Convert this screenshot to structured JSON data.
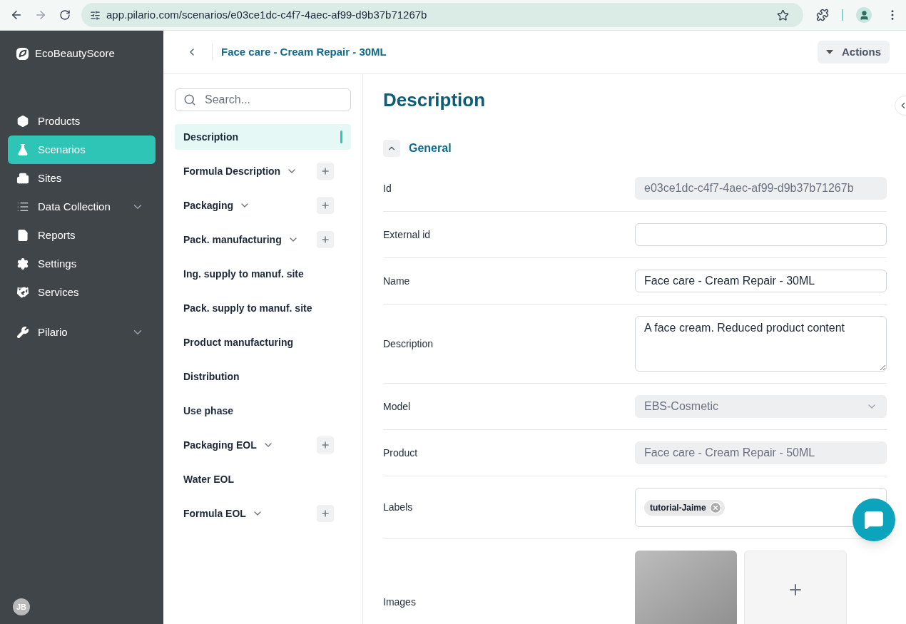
{
  "browser": {
    "url": "app.pilario.com/scenarios/e03ce1dc-c4f7-4aec-af99-d9b37b71267b"
  },
  "sidebar": {
    "brand": "EcoBeautyScore",
    "items": [
      {
        "label": "Products",
        "selected": false,
        "expandable": false
      },
      {
        "label": "Scenarios",
        "selected": true,
        "expandable": false
      },
      {
        "label": "Sites",
        "selected": false,
        "expandable": false
      },
      {
        "label": "Data Collection",
        "selected": false,
        "expandable": true
      },
      {
        "label": "Reports",
        "selected": false,
        "expandable": false
      },
      {
        "label": "Settings",
        "selected": false,
        "expandable": false
      },
      {
        "label": "Services",
        "selected": false,
        "expandable": false
      }
    ],
    "extra": [
      {
        "label": "Pilario",
        "selected": false,
        "expandable": true
      }
    ],
    "user_initials": "JB"
  },
  "header": {
    "title": "Face care - Cream Repair - 30ML",
    "actions": "Actions"
  },
  "sections": {
    "search_placeholder": "Search...",
    "items": [
      {
        "label": "Description",
        "selected": true,
        "expandable": false,
        "addable": false
      },
      {
        "label": "Formula Description",
        "selected": false,
        "expandable": true,
        "addable": true
      },
      {
        "label": "Packaging",
        "selected": false,
        "expandable": true,
        "addable": true
      },
      {
        "label": "Pack. manufacturing",
        "selected": false,
        "expandable": true,
        "addable": true
      },
      {
        "label": "Ing. supply to manuf. site",
        "selected": false,
        "expandable": false,
        "addable": false
      },
      {
        "label": "Pack. supply to manuf. site",
        "selected": false,
        "expandable": false,
        "addable": false
      },
      {
        "label": "Product manufacturing",
        "selected": false,
        "expandable": false,
        "addable": false
      },
      {
        "label": "Distribution",
        "selected": false,
        "expandable": false,
        "addable": false
      },
      {
        "label": "Use phase",
        "selected": false,
        "expandable": false,
        "addable": false
      },
      {
        "label": "Packaging EOL",
        "selected": false,
        "expandable": true,
        "addable": true
      },
      {
        "label": "Water EOL",
        "selected": false,
        "expandable": false,
        "addable": false
      },
      {
        "label": "Formula EOL",
        "selected": false,
        "expandable": true,
        "addable": true
      }
    ]
  },
  "content": {
    "title": "Description",
    "group": {
      "title": "General",
      "expanded": true
    },
    "fields": [
      {
        "label": "Id",
        "kind": "input",
        "disabled": true,
        "value": "e03ce1dc-c4f7-4aec-af99-d9b37b71267b"
      },
      {
        "label": "External id",
        "kind": "input",
        "disabled": false
      },
      {
        "label": "Name",
        "kind": "input",
        "disabled": false,
        "value": "Face care - Cream Repair - 30ML"
      },
      {
        "label": "Description",
        "kind": "textarea",
        "disabled": false,
        "value": "A face cream. Reduced product content"
      },
      {
        "label": "Model",
        "kind": "select",
        "disabled": true,
        "value": "EBS-Cosmetic"
      },
      {
        "label": "Product",
        "kind": "input",
        "disabled": true,
        "value": "Face care - Cream Repair - 50ML"
      },
      {
        "label": "Labels",
        "kind": "tags",
        "tags": [
          "tutorial-Jaime"
        ]
      },
      {
        "label": "Images",
        "kind": "images"
      }
    ]
  }
}
